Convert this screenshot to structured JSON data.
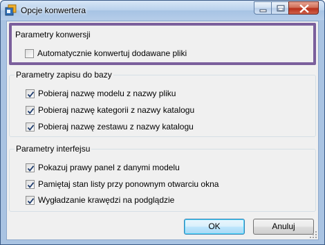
{
  "window": {
    "title": "Opcje konwertera"
  },
  "groups": [
    {
      "label": "Parametry konwersji",
      "items": [
        {
          "label": "Automatycznie konwertuj dodawane pliki",
          "checked": false
        }
      ]
    },
    {
      "label": "Parametry zapisu do bazy",
      "items": [
        {
          "label": "Pobieraj nazwę modelu z nazwy pliku",
          "checked": true
        },
        {
          "label": "Pobieraj nazwę kategorii z nazwy katalogu",
          "checked": true
        },
        {
          "label": "Pobieraj nazwę zestawu z nazwy katalogu",
          "checked": true
        }
      ]
    },
    {
      "label": "Parametry interfejsu",
      "items": [
        {
          "label": "Pokazuj prawy panel z danymi modelu",
          "checked": true
        },
        {
          "label": "Pamiętaj stan listy przy ponownym otwarciu okna",
          "checked": true
        },
        {
          "label": "Wygładzanie krawędzi na podglądzie",
          "checked": true
        }
      ]
    }
  ],
  "buttons": {
    "ok": "OK",
    "cancel": "Anuluj"
  },
  "colors": {
    "highlight_border": "#7b5f9c",
    "titlebar": "#b9d1ec",
    "close_button": "#c8452f"
  }
}
